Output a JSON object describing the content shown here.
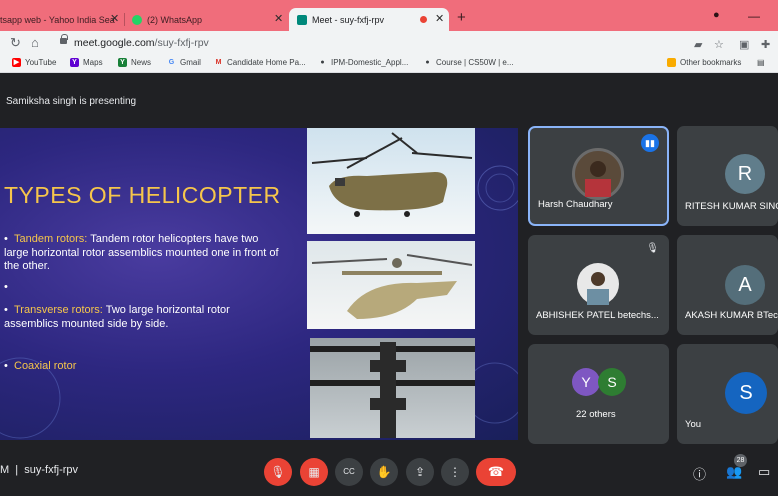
{
  "tabs": [
    {
      "title": "tsapp web - Yahoo India Sea",
      "favicon_color": "#7b3fd0"
    },
    {
      "title": "(2) WhatsApp",
      "favicon_color": "#25d366"
    },
    {
      "title": "Meet - suy-fxfj-rpv",
      "favicon_color": "#00897b",
      "active": true
    }
  ],
  "browser": {
    "url_host": "meet.google.com",
    "url_path": "/suy-fxfj-rpv",
    "new_tab": "+",
    "close": "✕",
    "minimize": "—"
  },
  "bookmarks": [
    {
      "label": "YouTube",
      "color": "#ff0000",
      "glyph": "▶"
    },
    {
      "label": "Maps",
      "color": "#6001d2",
      "glyph": "Y"
    },
    {
      "label": "News",
      "color": "#188038",
      "glyph": "Y"
    },
    {
      "label": "Gmail",
      "color": "#4285f4",
      "glyph": "G"
    },
    {
      "label": "Candidate Home Pa...",
      "color": "#d93025",
      "glyph": "M"
    },
    {
      "label": "IPM-Domestic_Appl...",
      "color": "#3c4043",
      "glyph": "●"
    },
    {
      "label": "Course | CS50W | e...",
      "color": "#3c4043",
      "glyph": "●"
    },
    {
      "label": "Other bookmarks",
      "color": "#f9ab00",
      "glyph": ""
    }
  ],
  "meet": {
    "presenting_text": "Samiksha singh is presenting",
    "meeting_code": "suy-fxfj-rpv",
    "code_prefix": "M",
    "participants_count": "28"
  },
  "slide": {
    "title": "TYPES OF  HELICOPTER",
    "bullets": [
      {
        "highlight": "Tandem rotors:",
        "text": " Tandem rotor helicopters have two large horizontal rotor assemblics mounted one in front of the other."
      },
      {
        "highlight": "",
        "text": ""
      },
      {
        "highlight": "Transverse rotors:",
        "text": " Two large horizontal rotor assemblics mounted side by side."
      },
      {
        "highlight": "Coaxial rotor",
        "text": ""
      }
    ]
  },
  "participants": [
    {
      "name": "Harsh Chaudhary",
      "speaking": true
    },
    {
      "name": "RITESH KUMAR SINGH",
      "initial": "R",
      "color": "#607d8b"
    },
    {
      "name": "ABHISHEK PATEL betechs...",
      "muted": true
    },
    {
      "name": "AKASH KUMAR BTech",
      "initial": "A",
      "color": "#546e7a"
    },
    {
      "name": "22 others",
      "initials": [
        "Y",
        "S"
      ],
      "colors": [
        "#7e57c2",
        "#2e7d32"
      ]
    },
    {
      "name": "You",
      "initial": "S",
      "color": "#1565c0"
    }
  ]
}
